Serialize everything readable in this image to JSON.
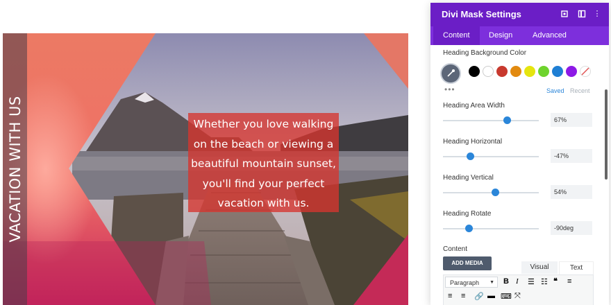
{
  "preview": {
    "vertical_heading": "VACATION WITH US",
    "quote": "Whether you love walking on the beach or viewing a beautiful mountain sunset, you'll find your perfect vacation with us."
  },
  "panel": {
    "title": "Divi Mask Settings",
    "header_icons": [
      "expand-icon",
      "sidebar-toggle-icon",
      "more-vertical-icon"
    ],
    "tabs": [
      {
        "label": "Content",
        "active": true
      },
      {
        "label": "Design",
        "active": false
      },
      {
        "label": "Advanced",
        "active": false
      }
    ],
    "heading_bg": {
      "label": "Heading Background Color",
      "swatches": [
        "#000000",
        "#ffffff",
        "#c8392e",
        "#e28a10",
        "#e5e50f",
        "#6ed32d",
        "#1f7fd4",
        "#8d19e6"
      ],
      "saved_label": "Saved",
      "recent_label": "Recent"
    },
    "sliders": [
      {
        "label": "Heading Area Width",
        "value": "67%",
        "position": 0.67
      },
      {
        "label": "Heading Horizontal",
        "value": "-47%",
        "position": 0.285
      },
      {
        "label": "Heading Vertical",
        "value": "54%",
        "position": 0.54
      },
      {
        "label": "Heading Rotate",
        "value": "-90deg",
        "position": 0.265
      }
    ],
    "content": {
      "label": "Content",
      "add_media": "ADD MEDIA",
      "visual_tab": "Visual",
      "text_tab": "Text",
      "paragraph_select": "Paragraph"
    }
  }
}
